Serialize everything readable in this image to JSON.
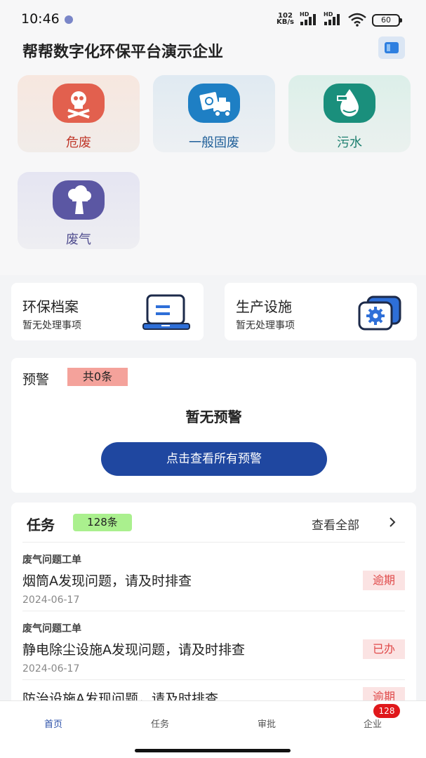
{
  "status_bar": {
    "time": "10:46",
    "net_speed_value": "102",
    "net_speed_unit": "KB/s",
    "hd1": "HD",
    "hd2": "HD",
    "battery": "60"
  },
  "header": {
    "company_title": "帮帮数字化环保平台演示企业",
    "corner_icon": "app-switch-icon"
  },
  "categories": [
    {
      "label": "危废",
      "icon": "skull-crossbones-icon",
      "label_color": "#c0392b",
      "card_color": "#f6e6df",
      "icon_color": "#e2604e"
    },
    {
      "label": "一般固废",
      "icon": "recycle-truck-icon",
      "label_color": "#1f5f99",
      "card_color": "#e1eaf1",
      "icon_color": "#1e7fc4"
    },
    {
      "label": "污水",
      "icon": "water-drop-icon",
      "label_color": "#1d7f6f",
      "card_color": "#dff0ec",
      "icon_color": "#1a8f7c"
    },
    {
      "label": "废气",
      "icon": "smoke-stack-icon",
      "label_color": "#4f4c8e",
      "card_color": "#e6e6f2",
      "icon_color": "#5b57a3"
    }
  ],
  "quick_panels": [
    {
      "title": "环保档案",
      "subtitle": "暂无处理事项",
      "icon": "laptop-document-icon"
    },
    {
      "title": "生产设施",
      "subtitle": "暂无处理事项",
      "icon": "gear-folder-icon"
    }
  ],
  "warning": {
    "title": "预警",
    "count_badge": "共0条",
    "empty_text": "暂无预警",
    "button_label": "点击查看所有预警"
  },
  "tasks": {
    "title": "任务",
    "count": "128条",
    "view_all": "查看全部",
    "items": [
      {
        "type": "废气问题工单",
        "title": "烟筒A发现问题，请及时排查",
        "date": "2024-06-17",
        "status": "逾期"
      },
      {
        "type": "废气问题工单",
        "title": "静电除尘设施A发现问题，请及时排查",
        "date": "2024-06-17",
        "status": "已办"
      },
      {
        "type": "",
        "title": "防治设施A发现问题，请及时排查",
        "date": "",
        "status": "逾期"
      }
    ]
  },
  "bottom_nav": {
    "items": [
      "首页",
      "任务",
      "审批",
      "企业"
    ],
    "active": "首页",
    "badge": "128"
  },
  "colors": {
    "primary": "#1f47a0",
    "badge_red": "#e0181b",
    "task_count_green": "#aaf08e",
    "warn_badge": "#f4a29b"
  }
}
